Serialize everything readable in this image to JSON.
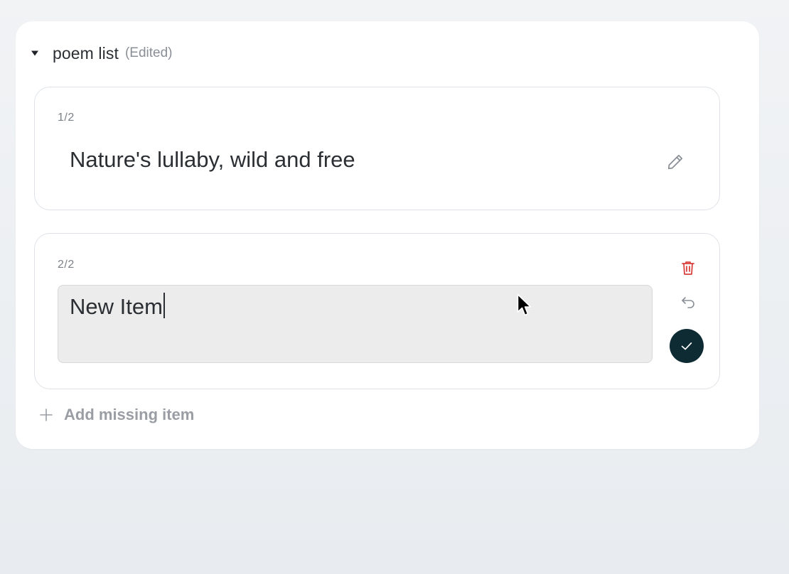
{
  "list": {
    "title": "poem list",
    "status": "(Edited)"
  },
  "items": [
    {
      "counter": "1/2",
      "text": "Nature's lullaby, wild and free"
    },
    {
      "counter": "2/2",
      "value": "New Item"
    }
  ],
  "add_item": {
    "label": "Add missing item"
  },
  "colors": {
    "delete": "#d9423f",
    "confirm": "#0e2a33",
    "muted": "#8a8f96"
  },
  "icons": [
    "caret-down-icon",
    "pencil-icon",
    "trash-icon",
    "undo-icon",
    "check-icon",
    "plus-icon",
    "mouse-pointer-icon"
  ]
}
